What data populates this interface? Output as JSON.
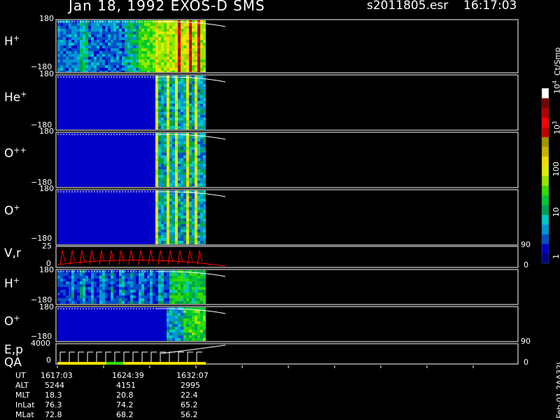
{
  "header": {
    "title": "Jan 18, 1992   EXOS-D SMS",
    "file": "s2011805.esr",
    "time": "16:17:03"
  },
  "colorbar": {
    "unit": "Ct/Smp",
    "ticks": [
      "1",
      "10",
      "100",
      "10",
      "10"
    ],
    "exponents": [
      "",
      "",
      "",
      "3",
      "4"
    ],
    "colors": [
      "#00008c",
      "#0000c8",
      "#0050c8",
      "#0096d2",
      "#00c8c8",
      "#00a050",
      "#00c832",
      "#32dc00",
      "#96e600",
      "#dcf000",
      "#f0dc00",
      "#c8b400",
      "#a09600",
      "#c80000",
      "#ff0000",
      "#b40000",
      "#780000",
      "#ffffff"
    ]
  },
  "panels": [
    {
      "label": "H",
      "sup": "+",
      "top": "180",
      "bottom": "−180"
    },
    {
      "label": "He",
      "sup": "+",
      "top": "180",
      "bottom": "−180"
    },
    {
      "label": "O",
      "sup": "++",
      "top": "180",
      "bottom": "−180"
    },
    {
      "label": "O",
      "sup": "+",
      "top": "180",
      "bottom": "−180"
    },
    {
      "label": "V,r",
      "sup": "",
      "top": "25",
      "bottom": "0",
      "right_top": "90",
      "right_bottom": "0"
    },
    {
      "label": "H",
      "sup": "+",
      "top": "180",
      "bottom": "−180"
    },
    {
      "label": "O",
      "sup": "+",
      "top": "180",
      "bottom": "−180"
    },
    {
      "label": "E,p",
      "label2": "QA",
      "top": "4000",
      "bottom": "0",
      "right_top": "90",
      "right_bottom": "0"
    }
  ],
  "footer": {
    "rows": [
      {
        "name": "UT",
        "values": [
          "1617:03",
          "1624:39",
          "1632:07"
        ]
      },
      {
        "name": "ALT",
        "values": [
          "5244",
          "4151",
          "2995"
        ]
      },
      {
        "name": "MLT",
        "values": [
          "18.3",
          "20.8",
          "22.4"
        ]
      },
      {
        "name": "InLat",
        "values": [
          "76.3",
          "74.2",
          "65.2"
        ]
      },
      {
        "name": "MLat",
        "values": [
          "72.8",
          "68.2",
          "56.2"
        ]
      }
    ],
    "id": "Feb-01 2AA32L"
  },
  "chart_data": {
    "type": "heatmap",
    "title": "Jan 18, 1992   EXOS-D SMS",
    "x": [
      "1617:03",
      "1624:39",
      "1632:07"
    ],
    "series": [
      {
        "name": "H+",
        "ylim": [
          -180,
          180
        ]
      },
      {
        "name": "He+",
        "ylim": [
          -180,
          180
        ]
      },
      {
        "name": "O++",
        "ylim": [
          -180,
          180
        ]
      },
      {
        "name": "O+",
        "ylim": [
          -180,
          180
        ]
      },
      {
        "name": "V,r",
        "ylim": [
          0,
          25
        ]
      },
      {
        "name": "H+",
        "ylim": [
          -180,
          180
        ]
      },
      {
        "name": "O+",
        "ylim": [
          -180,
          180
        ]
      },
      {
        "name": "E,p",
        "ylim": [
          0,
          4000
        ]
      }
    ],
    "colorbar_unit": "Ct/Smp",
    "colorbar_scale": "log",
    "colorbar_range": [
      1,
      10000
    ]
  }
}
